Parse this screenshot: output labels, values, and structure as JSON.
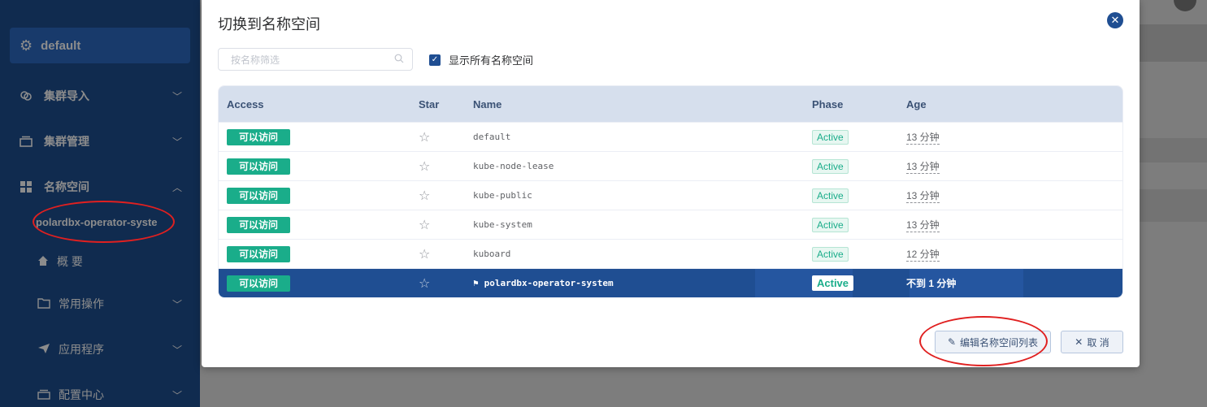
{
  "sidebar": {
    "current_namespace": "default",
    "items": [
      {
        "label": "集群导入"
      },
      {
        "label": "集群管理"
      },
      {
        "label": "名称空间"
      }
    ],
    "active_namespace": "polardbx-operator-syste",
    "sub_items": [
      {
        "label": "概 要"
      },
      {
        "label": "常用操作"
      },
      {
        "label": "应用程序"
      },
      {
        "label": "配置中心"
      }
    ]
  },
  "dialog": {
    "title": "切换到名称空间",
    "search_placeholder": "按名称筛选",
    "show_all_label": "显示所有名称空间",
    "columns": {
      "access": "Access",
      "star": "Star",
      "name": "Name",
      "phase": "Phase",
      "age": "Age"
    },
    "rows": [
      {
        "access": "可以访问",
        "name": "default",
        "phase": "Active",
        "age": "13 分钟"
      },
      {
        "access": "可以访问",
        "name": "kube-node-lease",
        "phase": "Active",
        "age": "13 分钟"
      },
      {
        "access": "可以访问",
        "name": "kube-public",
        "phase": "Active",
        "age": "13 分钟"
      },
      {
        "access": "可以访问",
        "name": "kube-system",
        "phase": "Active",
        "age": "13 分钟"
      },
      {
        "access": "可以访问",
        "name": "kuboard",
        "phase": "Active",
        "age": "12 分钟"
      },
      {
        "access": "可以访问",
        "name": "polardbx-operator-system",
        "phase": "Active",
        "age": "不到 1 分钟"
      }
    ],
    "edit_button": "编辑名称空间列表",
    "cancel_button": "取 消"
  },
  "colors": {
    "brand": "#1f4e92",
    "access_green": "#1aad8a",
    "annotation_red": "#e02020"
  }
}
